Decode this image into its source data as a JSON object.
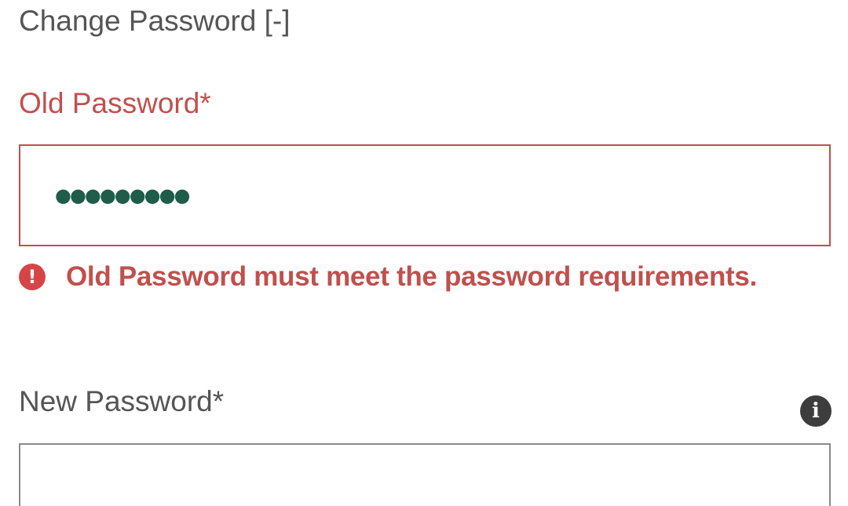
{
  "section": {
    "toggle_label": "Change Password [-]"
  },
  "old_password": {
    "label": "Old Password*",
    "masked_value": "●●●●●●●●●",
    "state": "error",
    "error_icon": "!",
    "error_message": "Old Password must meet the password requirements."
  },
  "new_password": {
    "label": "New Password*",
    "info_icon": "i",
    "value": ""
  },
  "colors": {
    "error": "#c0504d",
    "label": "#555555",
    "masked_dots": "#1f5c4a",
    "info_icon_bg": "#3d3d3d"
  }
}
